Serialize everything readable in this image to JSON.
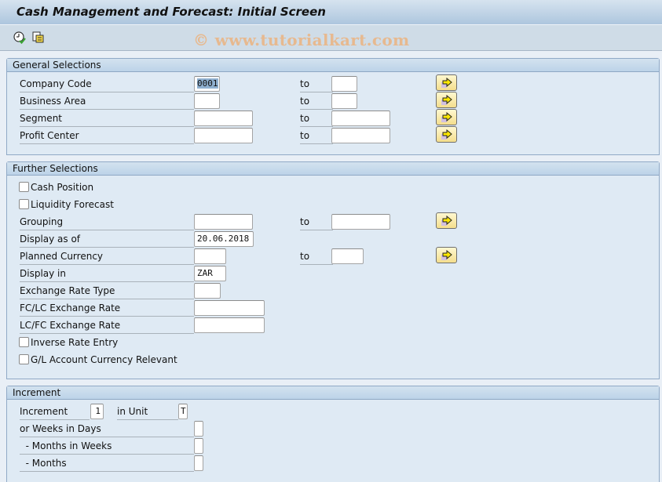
{
  "window": {
    "title": "Cash Management and Forecast: Initial Screen"
  },
  "toolbar": {
    "buttons": [
      {
        "icon": "execute-clock-check-icon",
        "tooltip": ""
      },
      {
        "icon": "copy-variant-icon",
        "tooltip": ""
      }
    ],
    "watermark": "© www.tutorialkart.com"
  },
  "general_selections": {
    "title": "General Selections",
    "to_label": "to",
    "rows": [
      {
        "label": "Company Code",
        "from": "0001",
        "to": ""
      },
      {
        "label": "Business Area",
        "from": "",
        "to": ""
      },
      {
        "label": "Segment",
        "from": "",
        "to": ""
      },
      {
        "label": "Profit Center",
        "from": "",
        "to": ""
      }
    ]
  },
  "further_selections": {
    "title": "Further Selections",
    "to_label": "to",
    "cash_position": {
      "label": "Cash Position",
      "checked": false
    },
    "liquidity_forecast": {
      "label": "Liquidity Forecast",
      "checked": false
    },
    "grouping": {
      "label": "Grouping",
      "from": "",
      "to": ""
    },
    "display_as_of": {
      "label": "Display as of",
      "value": "20.06.2018"
    },
    "planned_currency": {
      "label": "Planned Currency",
      "from": "",
      "to": ""
    },
    "display_in": {
      "label": "Display in",
      "value": "ZAR"
    },
    "exchange_rate_type": {
      "label": "Exchange Rate Type",
      "value": ""
    },
    "fc_lc_rate": {
      "label": "FC/LC Exchange Rate",
      "value": ""
    },
    "lc_fc_rate": {
      "label": "LC/FC Exchange Rate",
      "value": ""
    },
    "inverse_rate_entry": {
      "label": "Inverse Rate Entry",
      "checked": false
    },
    "gl_account_currency": {
      "label": "G/L Account Currency Relevant",
      "checked": false
    }
  },
  "increment": {
    "title": "Increment",
    "increment": {
      "label": "Increment",
      "value": "1"
    },
    "in_unit": {
      "label": "in Unit",
      "value": "T"
    },
    "weeks_in_days": {
      "label": "or Weeks in Days",
      "value": ""
    },
    "months_in_weeks": {
      "label": "  - Months in Weeks",
      "value": ""
    },
    "months": {
      "label": "  - Months",
      "value": ""
    }
  },
  "colors": {
    "title_bar": "#adc6de",
    "toolbar": "#cfdce7",
    "group_bg": "#dfeaf4",
    "multi_button": "#f4de8c",
    "watermark": "#e7b98f"
  }
}
